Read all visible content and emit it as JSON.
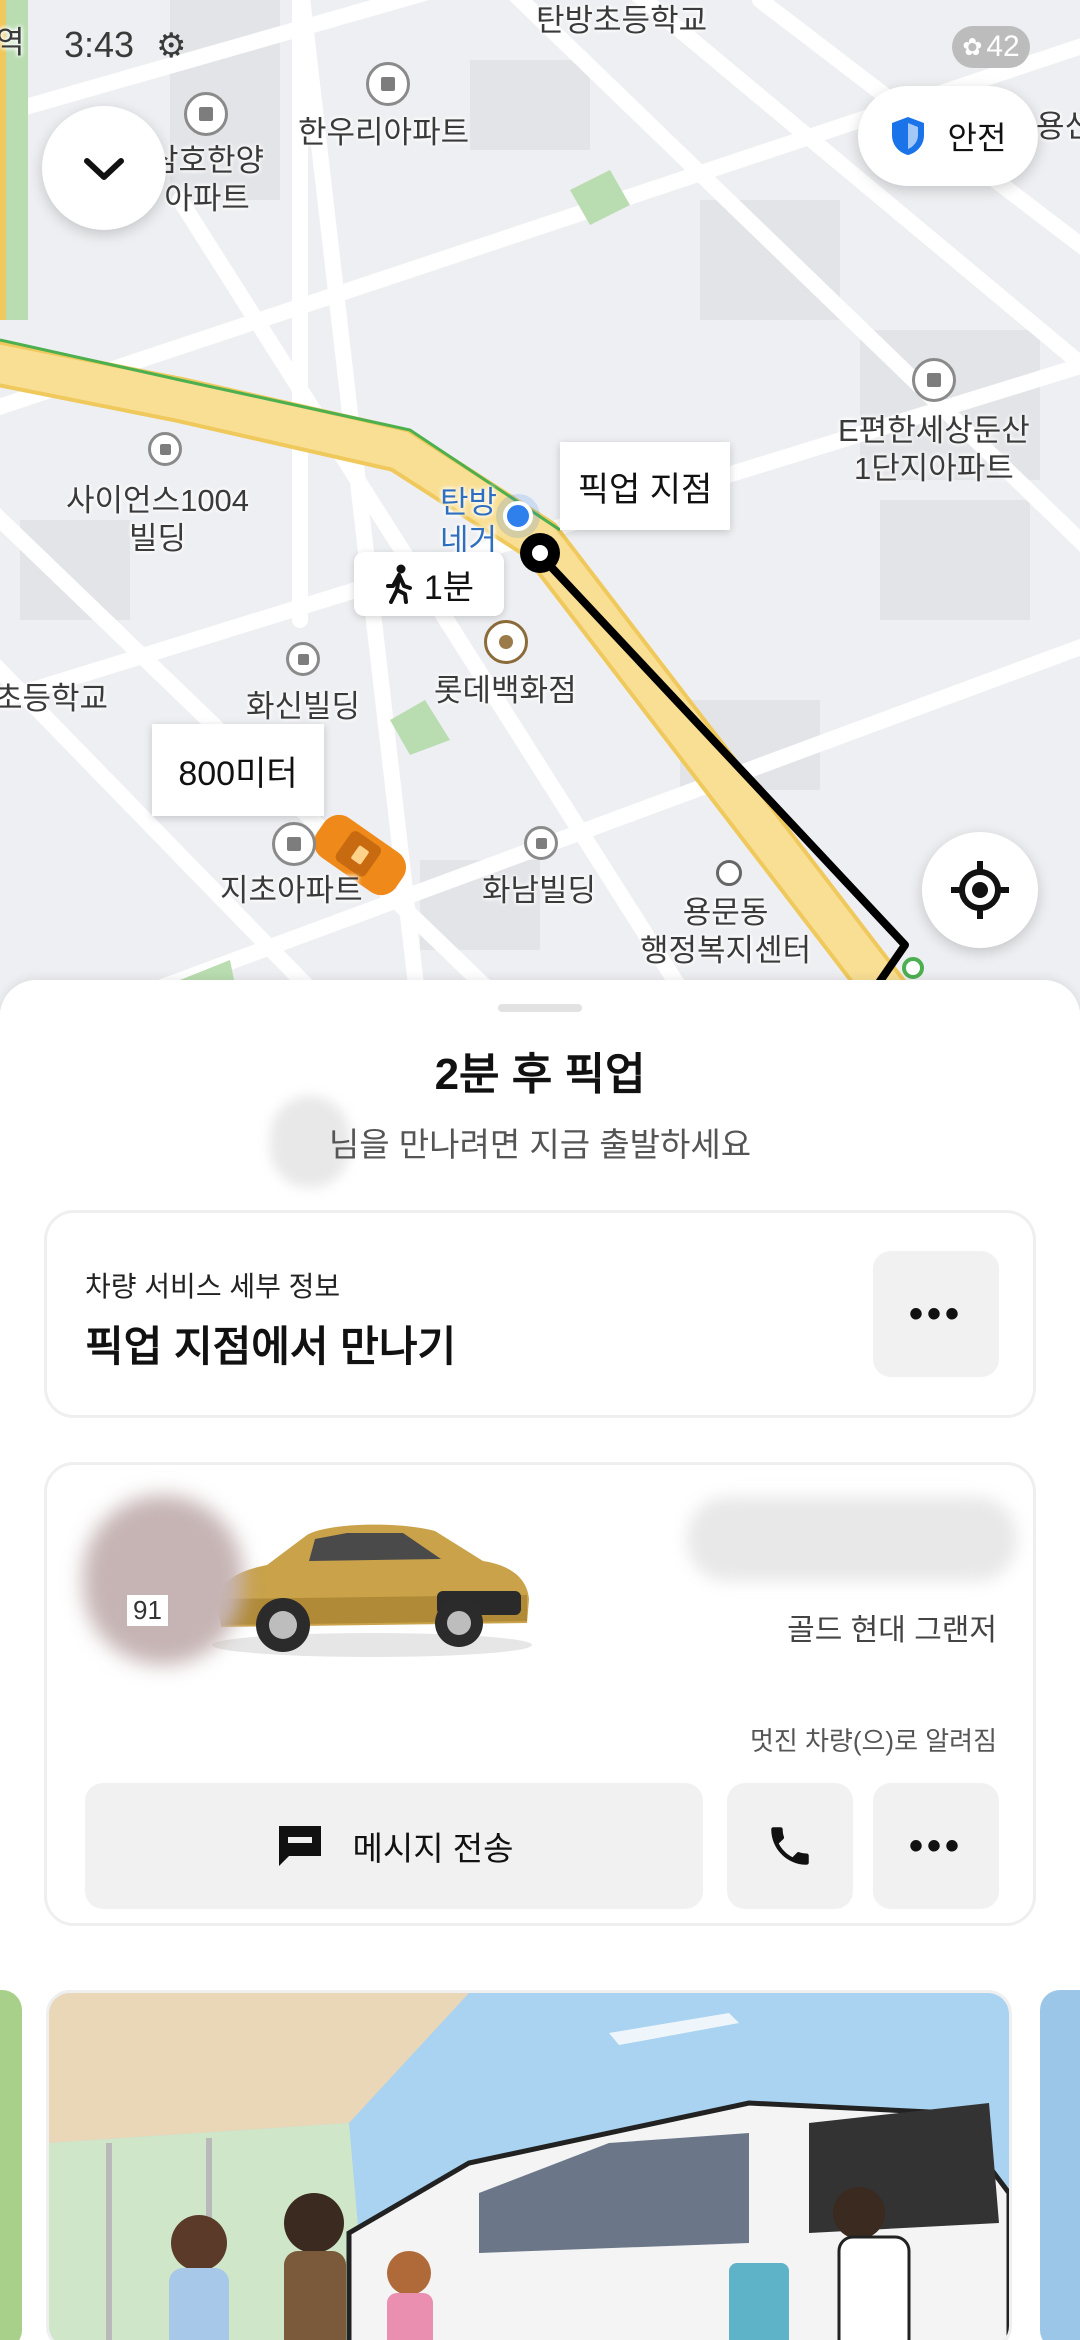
{
  "status_bar": {
    "time": "3:43",
    "battery": "42"
  },
  "map": {
    "labels": {
      "school_top": "탄방초등학교",
      "apt_hanwoo": "한우리아파트",
      "apt_samho": "삼호한양\n아파트",
      "apt_epyeonhan": "E편한세상둔산\n1단지아파트",
      "science_bldg": "사이언스1004\n빌딩",
      "tanbang_partial": "탄방\n네거",
      "hwasin_bldg": "화신빌딩",
      "lotte": "롯데백화점",
      "school_left": "초등학교",
      "jicho_apt": "지초아파트",
      "hwanam_bldg": "화남빌딩",
      "yongmun": "용문동\n행정복지센터",
      "station_partial": "역",
      "top_right_partial": "용신"
    },
    "pickup_callout": "픽업 지점",
    "walk_time": "1분",
    "distance": "800미터",
    "safety_label": "안전"
  },
  "sheet": {
    "title": "2분 후 픽업",
    "subtitle": "님을 만나려면 지금 출발하세요",
    "service_card": {
      "small_label": "차량 서비스 세부 정보",
      "main_label": "픽업 지점에서 만나기"
    },
    "vehicle_card": {
      "car_model": "골드 현대  그랜저",
      "note": "멋진 차량(으)로 알려짐",
      "rating_partial": "91",
      "message_label": "메시지 전송"
    }
  },
  "icons": {
    "collapse": "chevron-down-icon",
    "safety": "shield-icon",
    "locate": "crosshair-icon",
    "walk": "walking-person-icon",
    "message": "chat-bubble-icon",
    "phone": "phone-icon",
    "more": "more-dots-icon"
  },
  "colors": {
    "route": "#000000",
    "road_main": "#f7d67a",
    "user_dot": "#2f80ed",
    "shield": "#1a73e8",
    "taxi": "#ef8a1a"
  }
}
